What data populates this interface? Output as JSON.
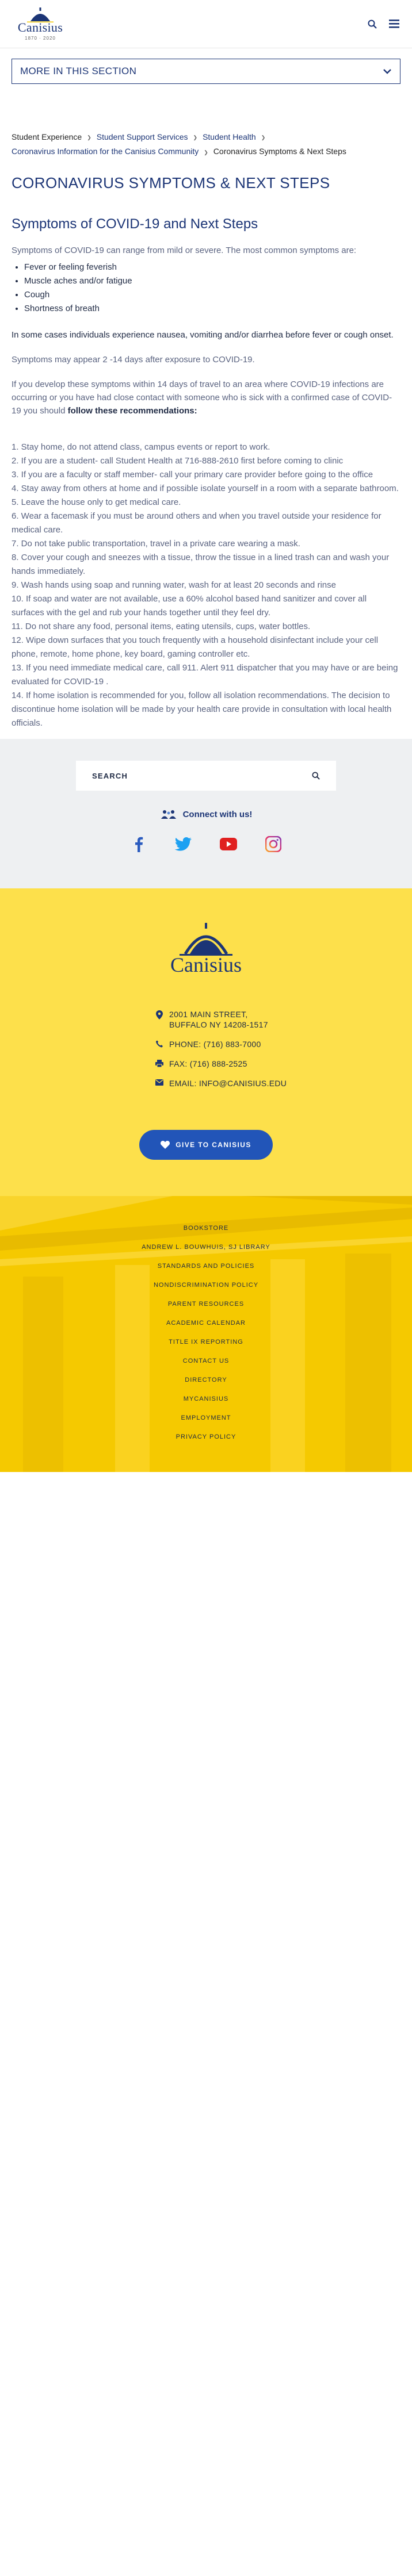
{
  "header": {
    "logo_text": "Canisius",
    "logo_years": "1870 · 2020"
  },
  "section_menu": {
    "label": "MORE IN THIS SECTION"
  },
  "breadcrumb": [
    {
      "label": "Student Experience",
      "link": false
    },
    {
      "label": "Student Support Services",
      "link": true
    },
    {
      "label": "Student Health",
      "link": true
    },
    {
      "label": "Coronavirus Information for the Canisius Community",
      "link": true
    },
    {
      "label": "Coronavirus Symptoms & Next Steps",
      "link": false
    }
  ],
  "page_title": "CORONAVIRUS SYMPTOMS & NEXT STEPS",
  "subtitle": "Symptoms of COVID-19 and Next Steps",
  "intro": "Symptoms of COVID-19 can range from mild or severe.  The most common symptoms are:",
  "symptoms": [
    "Fever or feeling feverish",
    "Muscle aches and/or fatigue",
    "Cough",
    "Shortness of breath"
  ],
  "other_symptoms": "In some cases individuals experience nausea, vomiting and/or diarrhea before fever or cough onset.",
  "appear": "Symptoms may appear 2 -14 days after exposure to COVID-19.",
  "develop_intro": "If you develop these symptoms within 14 days of travel to an area where COVID-19 infections are occurring or you have had close contact with someone who is sick with a confirmed case of COVID-19 you should ",
  "develop_bold": "follow these recommendations:",
  "recommendations": [
    "1. Stay home, do not attend class, campus events or report to work.",
    "2. If you are a student- call Student Health at 716-888-2610 first before coming to clinic",
    "3. If you are a faculty or staff member- call your primary care provider before going to the office",
    "4. Stay away from others at home and if possible isolate yourself in a room with a separate bathroom.",
    "5. Leave the house only to get medical care.",
    "6. Wear a facemask if you must be around others and when you travel outside your residence for medical care.",
    "7. Do not take public transportation, travel in a private care wearing a mask.",
    "8. Cover your cough and sneezes with a tissue, throw the tissue in a lined trash can and wash your hands immediately.",
    "9. Wash hands using soap and running water, wash for at least 20 seconds and rinse",
    "10. If soap and water are not available, use a 60% alcohol based hand sanitizer and cover all surfaces with the gel and rub your hands together until they feel dry.",
    "11. Do not share any food, personal items, eating utensils, cups, water bottles.",
    "12. Wipe down surfaces that you touch frequently with a household disinfectant include your cell phone, remote, home phone, key board, gaming controller etc.",
    "13. If you need immediate medical care, call 911.  Alert 911 dispatcher that you may have or are being evaluated for COVID-19 .",
    "14. If home isolation is recommended for  you, follow all isolation recommendations.  The decision to discontinue home isolation will be made by your health care provide in consultation with local health officials."
  ],
  "search": {
    "label": "SEARCH"
  },
  "connect": {
    "label": "Connect with us!"
  },
  "social": [
    "facebook-icon",
    "twitter-icon",
    "youtube-icon",
    "instagram-icon"
  ],
  "footer": {
    "logo_text": "Canisius",
    "address_line1": "2001 MAIN STREET,",
    "address_line2": "BUFFALO NY 14208-1517",
    "phone": "PHONE: (716) 883-7000",
    "fax": "FAX: (716) 888-2525",
    "email": "EMAIL: INFO@CANISIUS.EDU",
    "give_label": "GIVE TO CANISIUS",
    "links": [
      "BOOKSTORE",
      "ANDREW L. BOUWHUIS, SJ LIBRARY",
      "STANDARDS AND POLICIES",
      "NONDISCRIMINATION POLICY",
      "PARENT RESOURCES",
      "ACADEMIC CALENDAR",
      "TITLE IX REPORTING",
      "CONTACT US",
      "DIRECTORY",
      "MYCANISIUS",
      "EMPLOYMENT",
      "PRIVACY POLICY"
    ]
  },
  "colors": {
    "navy": "#1c3576",
    "yellow": "#fde04b",
    "gold": "#f5c900",
    "give_button": "#2255b8",
    "grey_band": "#eef0f2"
  }
}
